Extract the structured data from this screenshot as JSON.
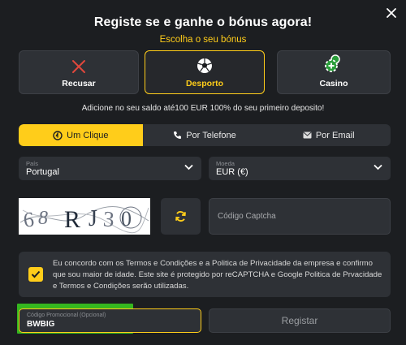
{
  "header": {
    "title": "Registe se e ganhe o bónus agora!",
    "subtitle": "Escolha o seu bónus"
  },
  "bonus_options": [
    {
      "label": "Recusar",
      "icon": "close-x-icon",
      "selected": false
    },
    {
      "label": "Desporto",
      "icon": "soccer-ball-icon",
      "selected": true
    },
    {
      "label": "Casino",
      "icon": "casino-chips-icon",
      "selected": false
    }
  ],
  "bonus_note": "Adicione no seu saldo até100 EUR 100% do seu primeiro deposito!",
  "tabs": [
    {
      "label": "Um Clique",
      "icon": "one-click-icon",
      "active": true
    },
    {
      "label": "Por Telefone",
      "icon": "phone-icon",
      "active": false
    },
    {
      "label": "Por Email",
      "icon": "email-icon",
      "active": false
    }
  ],
  "country": {
    "label": "País",
    "value": "Portugal"
  },
  "currency": {
    "label": "Moeda",
    "value": "EUR (€)"
  },
  "captcha": {
    "image_text": "68RJ30",
    "placeholder": "Código Captcha"
  },
  "terms": {
    "checked": true,
    "text": "Eu concordo com os Termos e Condições e a Politica de Privacidade da empresa e confirmo que sou maior de idade. Este site é protegido por reCAPTCHA e Google Politica de Prvacidade e Termos e Condições serão utilizadas."
  },
  "promo": {
    "label": "Código Promocional (Opcional)",
    "value": "BWBIG"
  },
  "register_label": "Registar",
  "colors": {
    "accent": "#ffcd1a",
    "background": "#1c1e21",
    "panel": "#2e3136",
    "highlight": "#39d21e"
  }
}
